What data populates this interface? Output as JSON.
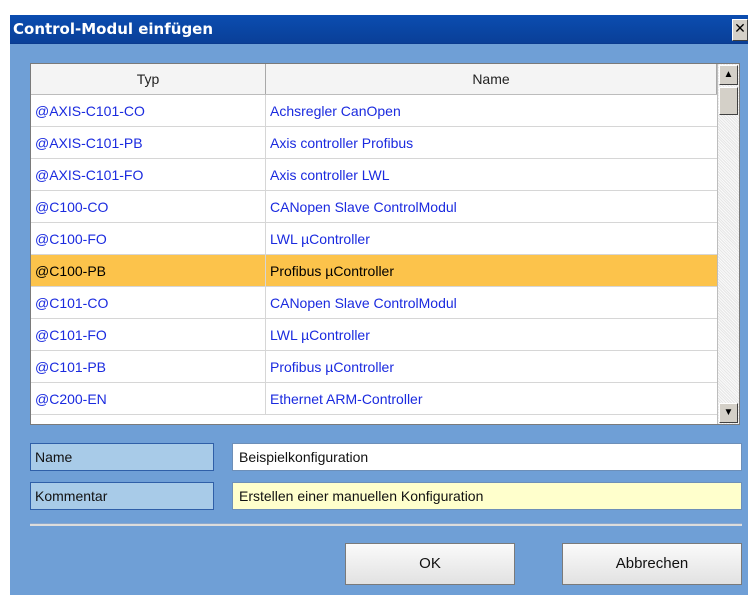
{
  "window": {
    "title": "Control-Modul einfügen",
    "close_glyph": "✕"
  },
  "list": {
    "columns": [
      "Typ",
      "Name"
    ],
    "rows": [
      {
        "typ": "@AXIS-C101-CO",
        "name": "Achsregler CanOpen",
        "selected": false
      },
      {
        "typ": "@AXIS-C101-PB",
        "name": "Axis controller Profibus",
        "selected": false
      },
      {
        "typ": "@AXIS-C101-FO",
        "name": "Axis controller LWL",
        "selected": false
      },
      {
        "typ": "@C100-CO",
        "name": "CANopen Slave ControlModul",
        "selected": false
      },
      {
        "typ": "@C100-FO",
        "name": "LWL µController",
        "selected": false
      },
      {
        "typ": "@C100-PB",
        "name": "Profibus µController",
        "selected": true
      },
      {
        "typ": "@C101-CO",
        "name": "CANopen Slave ControlModul",
        "selected": false
      },
      {
        "typ": "@C101-FO",
        "name": "LWL µController",
        "selected": false
      },
      {
        "typ": "@C101-PB",
        "name": "Profibus µController",
        "selected": false
      },
      {
        "typ": "@C200-EN",
        "name": "Ethernet ARM-Controller",
        "selected": false
      }
    ],
    "scroll_up_glyph": "▲",
    "scroll_down_glyph": "▼"
  },
  "form": {
    "name_label": "Name",
    "name_value": "Beispielkonfiguration",
    "comment_label": "Kommentar",
    "comment_value": "Erstellen einer manuellen Konfiguration"
  },
  "buttons": {
    "ok": "OK",
    "cancel": "Abbrechen"
  },
  "colors": {
    "selection": "#fcc34b",
    "row_text": "#1a2adf",
    "dialog_background": "#6f9fd6",
    "title_bar": "#0b4db0"
  }
}
